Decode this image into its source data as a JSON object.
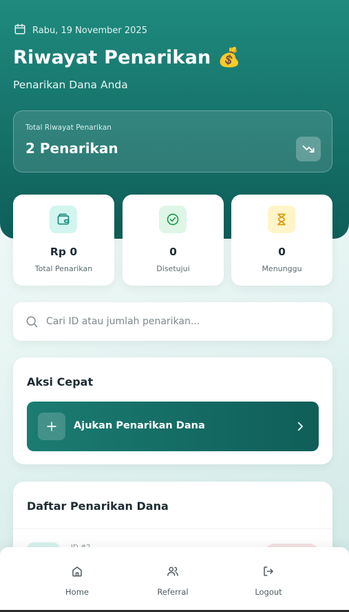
{
  "header": {
    "date": "Rabu, 19 November 2025",
    "title": "Riwayat Penarikan 💰",
    "subtitle": "Penarikan Dana Anda",
    "total_label": "Total Riwayat Penarikan",
    "total_value": "2 Penarikan"
  },
  "stats": [
    {
      "value": "Rp 0",
      "label": "Total Penarikan",
      "icon": "wallet-icon",
      "bg": "#d3f5ef",
      "fg": "#1a8a7e"
    },
    {
      "value": "0",
      "label": "Disetujui",
      "icon": "check-circle-icon",
      "bg": "#dff6e6",
      "fg": "#1f9a52"
    },
    {
      "value": "0",
      "label": "Menunggu",
      "icon": "hourglass-icon",
      "bg": "#fff5c8",
      "fg": "#d99a10"
    }
  ],
  "search": {
    "placeholder": "Cari ID atau jumlah penarikan..."
  },
  "quick_actions": {
    "title": "Aksi Cepat",
    "cta_label": "Ajukan Penarikan Dana"
  },
  "withdrawals": {
    "title": "Daftar Penarikan Dana",
    "first_id_peek": "ID #2"
  },
  "nav": [
    {
      "label": "Home",
      "icon": "home-icon"
    },
    {
      "label": "Referral",
      "icon": "users-icon"
    },
    {
      "label": "Logout",
      "icon": "logout-icon"
    }
  ],
  "colors": {
    "primary": "#1f8a7f",
    "primary_dark": "#0f5e58"
  }
}
